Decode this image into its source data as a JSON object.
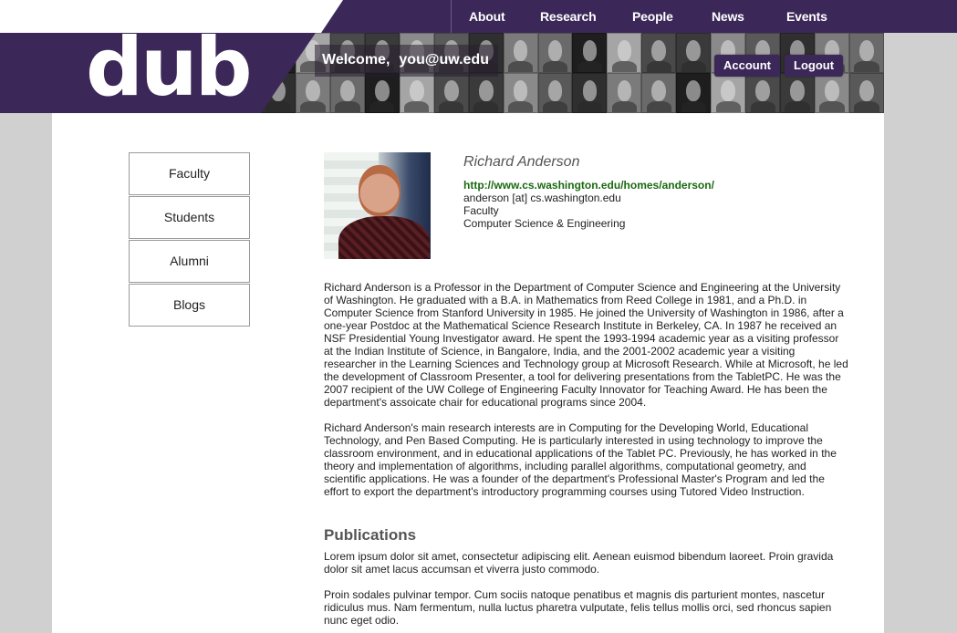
{
  "nav": {
    "items": [
      "About",
      "Research",
      "People",
      "News",
      "Events"
    ]
  },
  "header": {
    "logo": "dub",
    "welcome_label": "Welcome,",
    "user_email": "you@uw.edu",
    "account_label": "Account",
    "logout_label": "Logout"
  },
  "sidebar": {
    "items": [
      "Faculty",
      "Students",
      "Alumni",
      "Blogs"
    ]
  },
  "profile": {
    "name": "Richard Anderson",
    "url": "http://www.cs.washington.edu/homes/anderson/",
    "email": "anderson [at] cs.washington.edu",
    "role": "Faculty",
    "department": "Computer Science & Engineering",
    "bio_1": "Richard Anderson is a Professor in the Department of Computer Science and Engineering at the University of Washington. He graduated with a B.A. in Mathematics from Reed College in 1981, and a Ph.D. in Computer Science from Stanford University in 1985. He joined the University of Washington in 1986, after a one-year Postdoc at the Mathematical Science Research Institute in Berkeley, CA. In 1987 he received an NSF Presidential Young Investigator award. He spent the 1993-1994 academic year as a visiting professor at the Indian Institute of Science, in Bangalore, India, and the 2001-2002 academic year a visiting researcher in the Learning Sciences and Technology group at Microsoft Research. While at Microsoft, he led the development of Classroom Presenter, a tool for delivering presentations from the TabletPC. He was the 2007 recipient of the UW College of Engineering Faculty Innovator for Teaching Award. He has been the department's assoicate chair for educational programs since 2004.",
    "bio_2": "Richard Anderson's main research interests are in Computing for the Developing World, Educational Technology, and Pen Based Computing. He is particularly interested in using technology to improve the classroom environment, and in educational applications of the Tablet PC. Previously, he has worked in the theory and implementation of algorithms, including parallel algorithms, computational geometry, and scientific applications. He was a founder of the department's Professional Master's Program and led the effort to export the department's introductory programming courses using Tutored Video Instruction."
  },
  "publications": {
    "heading": "Publications",
    "items": [
      "Lorem ipsum dolor sit amet, consectetur adipiscing elit. Aenean euismod bibendum laoreet. Proin gravida dolor sit amet lacus accumsan et viverra justo commodo.",
      "Proin sodales pulvinar tempor. Cum sociis natoque penatibus et magnis dis parturient montes, nascetur ridiculus mus. Nam fermentum, nulla luctus pharetra vulputate, felis tellus mollis orci, sed rhoncus sapien nunc eget odio."
    ]
  }
}
